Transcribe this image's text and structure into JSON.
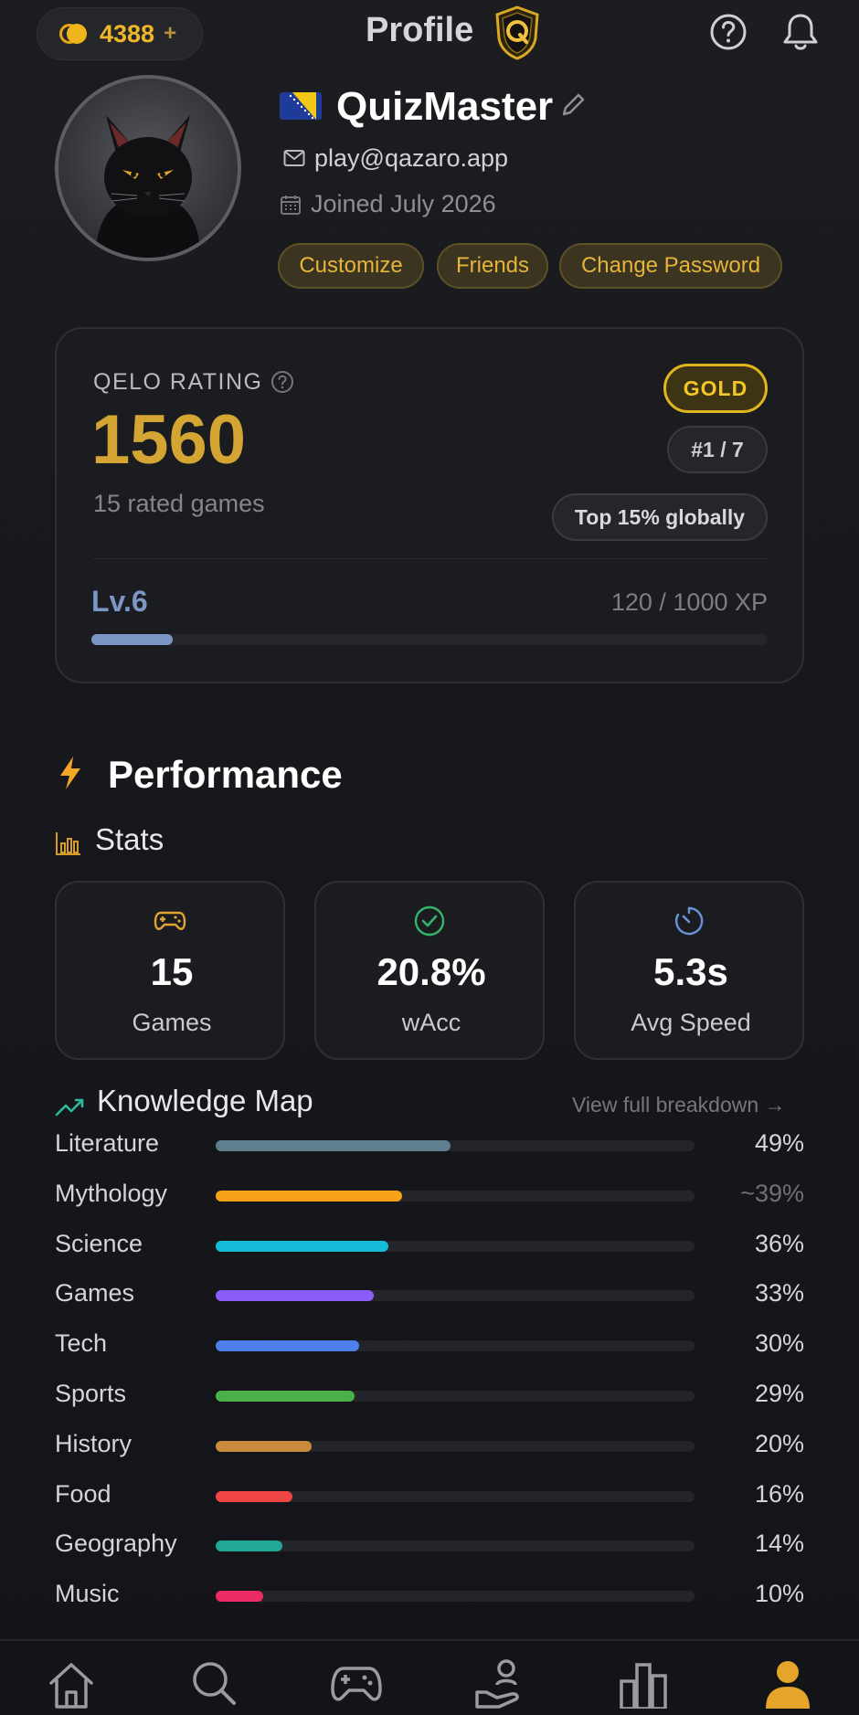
{
  "header": {
    "coins": "4388",
    "coins_plus": "+",
    "title": "Profile",
    "icons": [
      "q-logo-badge",
      "help-icon",
      "bell-icon"
    ]
  },
  "profile": {
    "username": "QuizMaster",
    "flag": "bosnia-herzegovina-flag",
    "email": "play@qazaro.app",
    "joined": "Joined July 2026",
    "buttons": [
      "Customize",
      "Friends",
      "Change Password"
    ]
  },
  "rating": {
    "label": "QELO RATING",
    "value": "1560",
    "rated_games": "15 rated games",
    "tier": "GOLD",
    "rank": "#1 / 7",
    "percentile": "Top 15% globally",
    "level": "Lv.6",
    "xp": "120 / 1000 XP",
    "xp_progress": 0.12
  },
  "performance": {
    "title": "Performance",
    "stats_title": "Stats",
    "stats": [
      {
        "icon": "gamepad-icon",
        "value": "15",
        "label": "Games"
      },
      {
        "icon": "check-circle-icon",
        "value": "20.8%",
        "label": "wAcc"
      },
      {
        "icon": "timer-icon",
        "value": "5.3s",
        "label": "Avg Speed"
      }
    ]
  },
  "knowledge_map": {
    "title": "Knowledge Map",
    "link": "View full breakdown →",
    "categories": [
      {
        "name": "Literature",
        "pct": "49%",
        "value": 49,
        "color": "#5f7f8f"
      },
      {
        "name": "Mythology",
        "pct": "~39%",
        "value": 39,
        "color": "#f5a216"
      },
      {
        "name": "Science",
        "pct": "36%",
        "value": 36,
        "color": "#14bcd8"
      },
      {
        "name": "Games",
        "pct": "33%",
        "value": 33,
        "color": "#8b5cf6"
      },
      {
        "name": "Tech",
        "pct": "30%",
        "value": 30,
        "color": "#4f7fea"
      },
      {
        "name": "Sports",
        "pct": "29%",
        "value": 29,
        "color": "#49b04c"
      },
      {
        "name": "History",
        "pct": "20%",
        "value": 20,
        "color": "#c98b3b"
      },
      {
        "name": "Food",
        "pct": "16%",
        "value": 16,
        "color": "#ee4444"
      },
      {
        "name": "Geography",
        "pct": "14%",
        "value": 14,
        "color": "#21a796"
      },
      {
        "name": "Music",
        "pct": "10%",
        "value": 10,
        "color": "#ec2a63"
      }
    ]
  },
  "nav": {
    "items": [
      "home-icon",
      "search-icon",
      "gamepad-icon",
      "hand-person-icon",
      "leaderboard-icon",
      "profile-icon"
    ],
    "active": "profile-icon"
  }
}
